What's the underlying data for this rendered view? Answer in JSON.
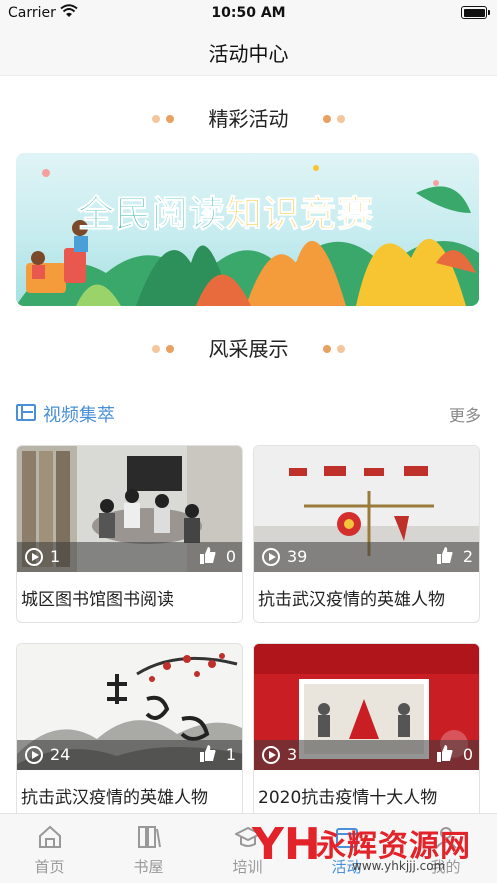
{
  "status_bar": {
    "carrier": "Carrier",
    "time": "10:50 AM"
  },
  "nav": {
    "title": "活动中心"
  },
  "sections": {
    "featured_title": "精彩活动",
    "showcase_title": "风采展示"
  },
  "banner": {
    "text_part1": "全民阅读",
    "text_part2": "知识竞赛"
  },
  "video_section": {
    "label": "视频集萃",
    "more": "更多"
  },
  "videos": [
    {
      "views": "1",
      "likes": "0",
      "title": "城区图书馆图书阅读"
    },
    {
      "views": "39",
      "likes": "2",
      "title": "抗击武汉疫情的英雄人物"
    },
    {
      "views": "24",
      "likes": "1",
      "title": "抗击武汉疫情的英雄人物"
    },
    {
      "views": "3",
      "likes": "0",
      "title": "2020抗击疫情十大人物"
    }
  ],
  "tabs": [
    {
      "label": "首页",
      "icon": "home-icon"
    },
    {
      "label": "书屋",
      "icon": "books-icon"
    },
    {
      "label": "培训",
      "icon": "graduation-cap-icon"
    },
    {
      "label": "活动",
      "icon": "activity-icon"
    },
    {
      "label": "我的",
      "icon": "person-icon"
    }
  ],
  "watermark": {
    "logo": "YH",
    "name": "永辉资源网",
    "url": "www.yhkjjj.com"
  },
  "colors": {
    "accent": "#4a90d9",
    "dot_light": "#f3c69b",
    "dot_dark": "#e9a060",
    "watermark_red": "#e2232a"
  }
}
